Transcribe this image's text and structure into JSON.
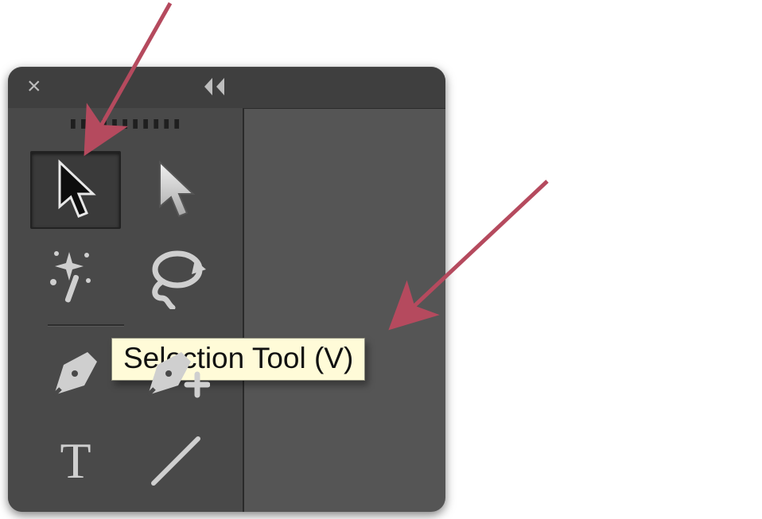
{
  "panel": {
    "close_label": "×",
    "collapse_label": "◂◂"
  },
  "tools": {
    "selection": {
      "name": "Selection Tool",
      "shortcut": "V",
      "selected": true
    },
    "direct_selection": {
      "name": "Direct Selection Tool",
      "selected": false
    },
    "magic_wand": {
      "name": "Magic Wand Tool",
      "selected": false
    },
    "lasso": {
      "name": "Lasso Tool",
      "selected": false
    },
    "pen": {
      "name": "Pen Tool",
      "selected": false
    },
    "add_anchor": {
      "name": "Add Anchor Point Tool",
      "selected": false
    },
    "type": {
      "name": "Type Tool",
      "selected": false
    },
    "line": {
      "name": "Line Segment Tool",
      "selected": false
    }
  },
  "tooltip": {
    "text": "Selection Tool (V)"
  },
  "annotations": {
    "arrow_color": "#B54A5E"
  }
}
